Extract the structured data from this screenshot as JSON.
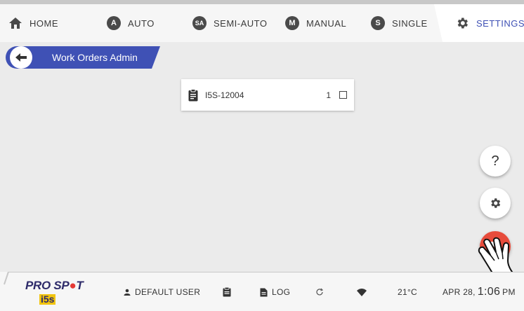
{
  "tabs": [
    {
      "id": "home",
      "label": "HOME",
      "icon": "home-icon"
    },
    {
      "id": "auto",
      "label": "AUTO",
      "icon": "auto-badge-icon",
      "badge": "A"
    },
    {
      "id": "semiauto",
      "label": "SEMI-AUTO",
      "icon": "semi-auto-badge-icon",
      "badge": "SA"
    },
    {
      "id": "manual",
      "label": "MANUAL",
      "icon": "manual-badge-icon",
      "badge": "M"
    },
    {
      "id": "single",
      "label": "SINGLE",
      "icon": "single-badge-icon",
      "badge": "S"
    },
    {
      "id": "settings",
      "label": "SETTINGS",
      "icon": "settings-gear-icon",
      "active": true
    }
  ],
  "breadcrumb": {
    "title": "Work Orders Admin"
  },
  "work_orders": [
    {
      "name": "I5S-12004",
      "qty": "1",
      "checked": false
    }
  ],
  "fabs": {
    "help_label": "?"
  },
  "status": {
    "brand": "PRO SP",
    "brand_tail": "T",
    "brand_sub": "i5s",
    "user": "DEFAULT USER",
    "log": "LOG",
    "temperature": "21°C",
    "date": "APR 28,",
    "time": "1:06",
    "ampm": "PM"
  },
  "colors": {
    "accent": "#3f51b5",
    "fab_red": "#e74c3c",
    "brand_navy": "#2e2b6a",
    "brand_red": "#e53935"
  }
}
